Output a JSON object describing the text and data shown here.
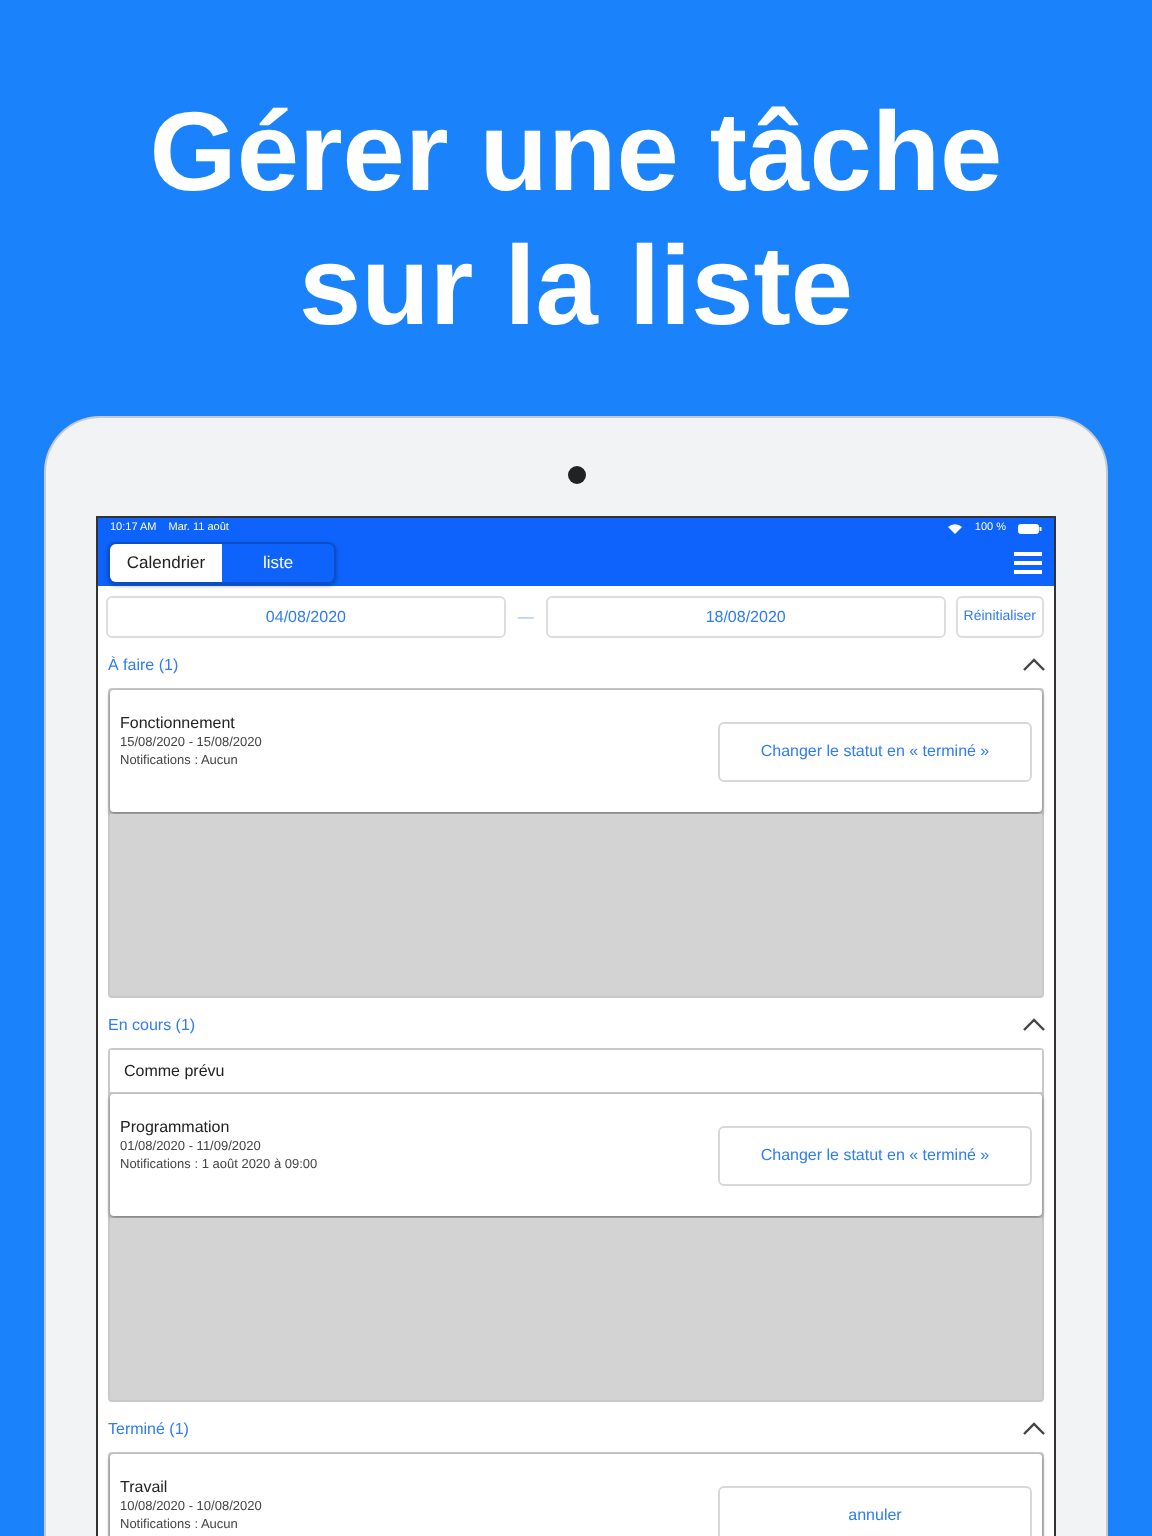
{
  "headline": "Gérer une tâche sur la liste",
  "status_bar": {
    "time": "10:17 AM",
    "date": "Mar. 11 août",
    "battery": "100 %"
  },
  "tabs": [
    {
      "label": "Calendrier",
      "selected": true
    },
    {
      "label": "liste",
      "selected": false
    }
  ],
  "date_range": {
    "start": "04/08/2020",
    "separator": "—",
    "end": "18/08/2020",
    "reset": "Réinitialiser"
  },
  "sections": [
    {
      "title": "À faire (1)",
      "expanded": true,
      "tasks": [
        {
          "title": "Fonctionnement",
          "dates": "15/08/2020 - 15/08/2020",
          "notifications": "Notifications : Aucun",
          "action": "Changer le statut en « terminé »"
        }
      ]
    },
    {
      "title": "En cours (1)",
      "expanded": true,
      "group": "Comme prévu",
      "tasks": [
        {
          "title": "Programmation",
          "dates": "01/08/2020 - 11/09/2020",
          "notifications": "Notifications : 1 août 2020 à 09:00",
          "action": "Changer le statut en « terminé »"
        }
      ]
    },
    {
      "title": "Terminé (1)",
      "expanded": true,
      "tasks": [
        {
          "title": "Travail",
          "dates": "10/08/2020 - 10/08/2020",
          "notifications": "Notifications : Aucun",
          "action": "annuler"
        }
      ]
    }
  ]
}
